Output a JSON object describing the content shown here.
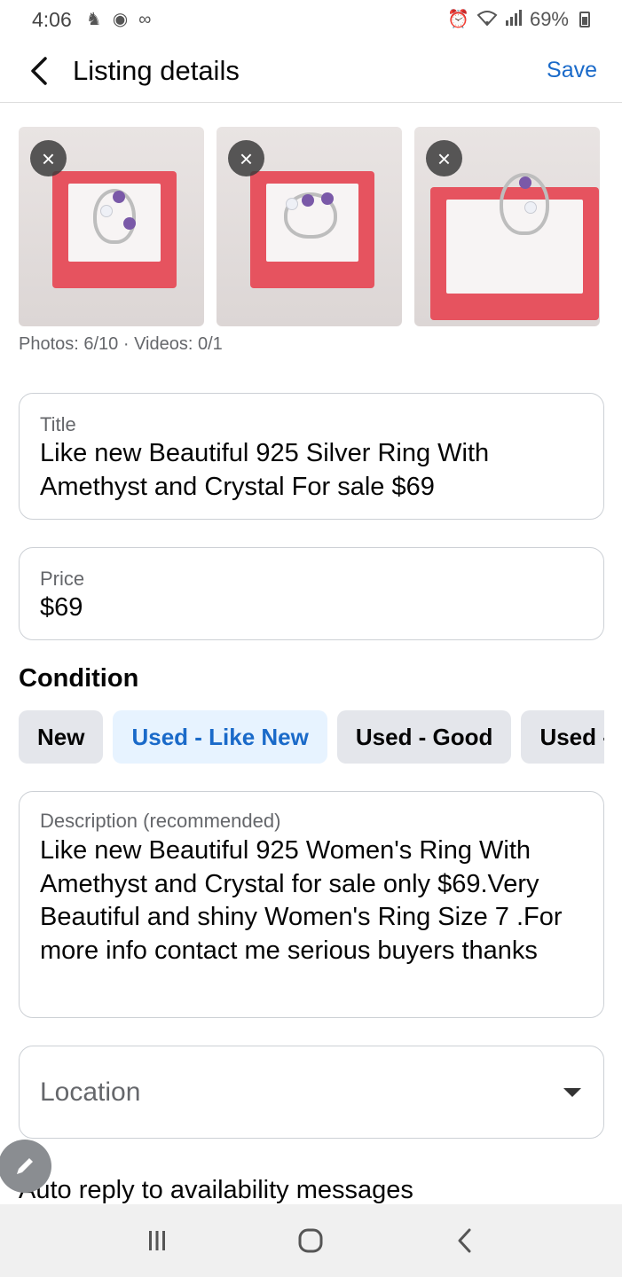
{
  "status_bar": {
    "time": "4:06",
    "battery": "69%",
    "left_icons": [
      "notification-icon",
      "account-icon",
      "voicemail-icon"
    ],
    "right_icons": [
      "alarm-icon",
      "wifi-icon",
      "signal-icon",
      "battery-icon"
    ]
  },
  "header": {
    "title": "Listing details",
    "save_label": "Save"
  },
  "photos": {
    "count_text": "Photos: 6/10 · Videos: 0/1",
    "remove_glyph": "×"
  },
  "title_field": {
    "label": "Title",
    "value": "Like new Beautiful 925 Silver Ring With Amethyst and Crystal For sale $69"
  },
  "price_field": {
    "label": "Price",
    "value": "$69"
  },
  "condition": {
    "title": "Condition",
    "options": [
      "New",
      "Used - Like New",
      "Used - Good",
      "Used - Fair"
    ],
    "selected": "Used - Like New"
  },
  "description_field": {
    "label": "Description (recommended)",
    "value": "Like new Beautiful 925 Women's Ring With Amethyst and Crystal for sale only $69.Very Beautiful and shiny Women's Ring Size 7 .For more info contact me serious buyers thanks"
  },
  "location_field": {
    "placeholder": "Location"
  },
  "auto_reply": {
    "label": "Auto reply to availability messages"
  },
  "colors": {
    "accent": "#1a6ac9",
    "chip_selected_bg": "#e7f3ff",
    "chip_bg": "#e4e6eb"
  }
}
